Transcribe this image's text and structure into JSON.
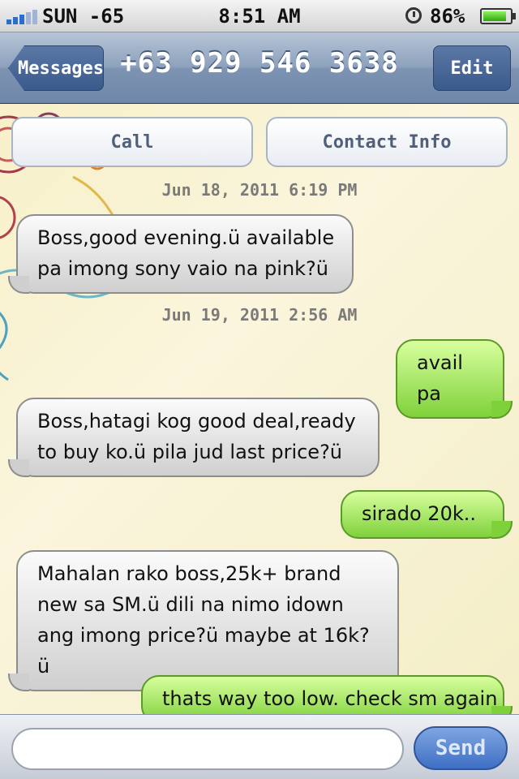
{
  "status_bar": {
    "carrier": "SUN -65",
    "time": "8:51 AM",
    "battery_percent": "86%",
    "battery_level": 0.86,
    "icons": [
      "signal-icon",
      "alarm-icon",
      "battery-icon"
    ]
  },
  "nav": {
    "back_label": "Messages",
    "title": "+63 929 546 3638",
    "edit_label": "Edit"
  },
  "actions": {
    "call_label": "Call",
    "contact_label": "Contact Info"
  },
  "timestamps": [
    "Jun 18, 2011 6:19 PM",
    "Jun 19, 2011 2:56 AM"
  ],
  "messages": [
    {
      "direction": "in",
      "text": "Boss,good evening.ü available pa imong sony vaio na pink?ü"
    },
    {
      "direction": "out",
      "text": "avail pa"
    },
    {
      "direction": "in",
      "text": "Boss,hatagi kog good deal,ready to buy ko.ü pila jud last price?ü"
    },
    {
      "direction": "out",
      "text": "sirado 20k.."
    },
    {
      "direction": "in",
      "text": "Mahalan rako boss,25k+ brand new sa SM.ü dili na nimo idown ang imong price?ü maybe at 16k?ü"
    },
    {
      "direction": "out",
      "text": "thats way too low. check sm again"
    }
  ],
  "compose": {
    "placeholder": "",
    "send_label": "Send"
  },
  "colors": {
    "incoming_bubble": "#d9d9d9",
    "outgoing_bubble": "#8fdb4a",
    "nav_bar": "#7d93b2",
    "send_button": "#4f7fd0"
  }
}
